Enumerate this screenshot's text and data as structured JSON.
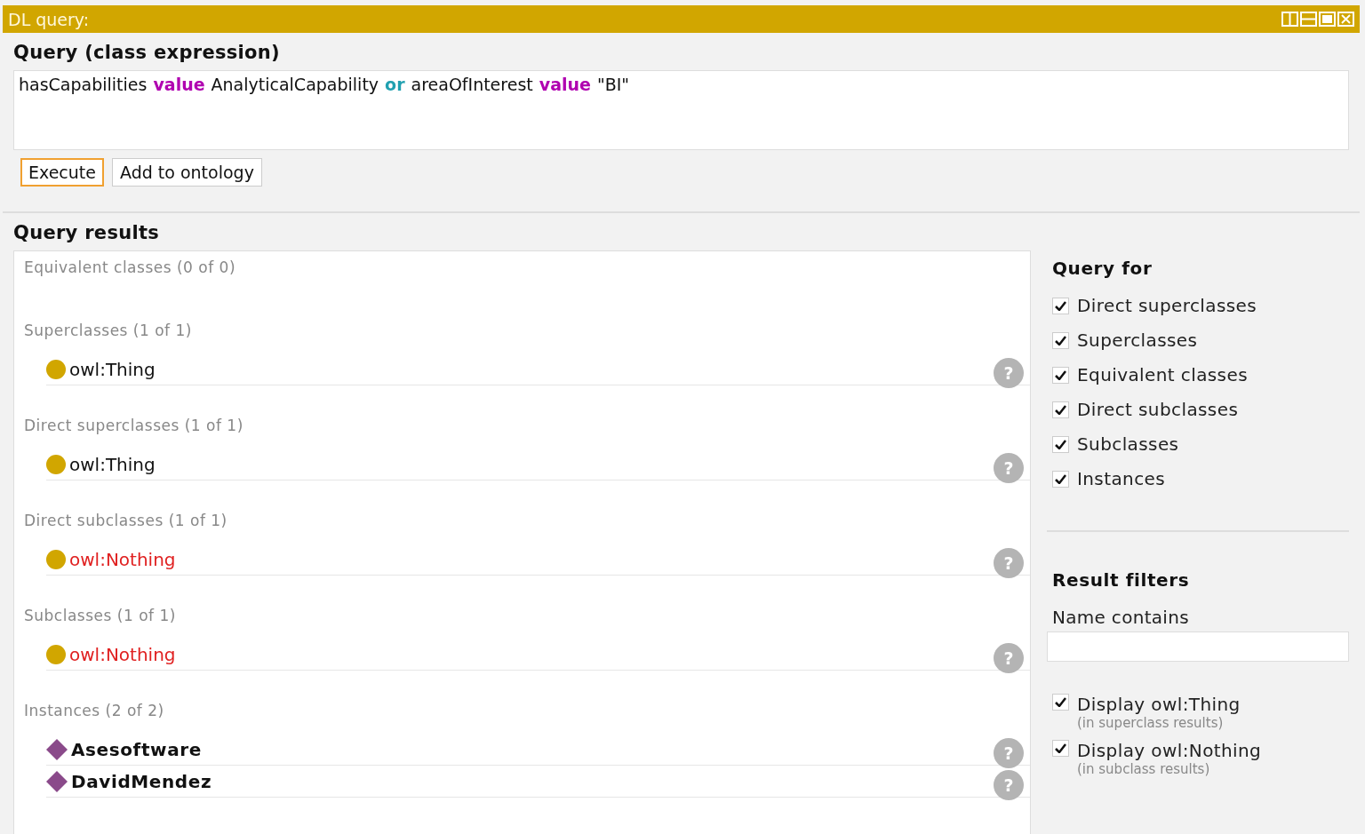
{
  "window": {
    "title": "DL query:"
  },
  "query": {
    "heading": "Query (class expression)",
    "tokens": [
      {
        "text": "hasCapabilities",
        "kind": "plain"
      },
      {
        "text": "value",
        "kind": "keyword"
      },
      {
        "text": "AnalyticalCapability",
        "kind": "plain"
      },
      {
        "text": "or",
        "kind": "operator"
      },
      {
        "text": "areaOfInterest",
        "kind": "plain"
      },
      {
        "text": "value",
        "kind": "keyword"
      },
      {
        "text": "\"BI\"",
        "kind": "plain"
      }
    ],
    "buttons": [
      {
        "label": "Execute",
        "focused": true
      },
      {
        "label": "Add to ontology",
        "focused": false
      }
    ]
  },
  "results": {
    "heading": "Query results",
    "sections": [
      {
        "label": "Equivalent classes (0 of 0)"
      },
      {
        "label": "Superclasses (1 of 1)",
        "entries": [
          {
            "name": "owl:Thing",
            "kind": "class",
            "unsatisfiable": false,
            "help": "?"
          }
        ]
      },
      {
        "label": "Direct superclasses (1 of 1)",
        "entries": [
          {
            "name": "owl:Thing",
            "kind": "class",
            "unsatisfiable": false,
            "help": "?"
          }
        ]
      },
      {
        "label": "Direct subclasses (1 of 1)",
        "entries": [
          {
            "name": "owl:Nothing",
            "kind": "class",
            "unsatisfiable": true,
            "help": "?"
          }
        ]
      },
      {
        "label": "Subclasses (1 of 1)",
        "entries": [
          {
            "name": "owl:Nothing",
            "kind": "class",
            "unsatisfiable": true,
            "help": "?"
          }
        ]
      },
      {
        "label": "Instances (2 of 2)",
        "entries": [
          {
            "name": "Asesoftware",
            "kind": "individual",
            "unsatisfiable": false,
            "help": "?"
          },
          {
            "name": "DavidMendez",
            "kind": "individual",
            "unsatisfiable": false,
            "help": "?"
          }
        ]
      }
    ]
  },
  "query_for": {
    "heading": "Query for",
    "options": [
      {
        "label": "Direct superclasses",
        "checked": true
      },
      {
        "label": "Superclasses",
        "checked": true
      },
      {
        "label": "Equivalent classes",
        "checked": true
      },
      {
        "label": "Direct subclasses",
        "checked": true
      },
      {
        "label": "Subclasses",
        "checked": true
      },
      {
        "label": "Instances",
        "checked": true
      }
    ]
  },
  "result_filters": {
    "heading": "Result filters",
    "name_label": "Name contains",
    "options": [
      {
        "label": "Display owl:Thing",
        "note": "(in superclass results)",
        "checked": true
      },
      {
        "label": "Display owl:Nothing",
        "note": "(in subclass results)",
        "checked": true
      }
    ]
  }
}
